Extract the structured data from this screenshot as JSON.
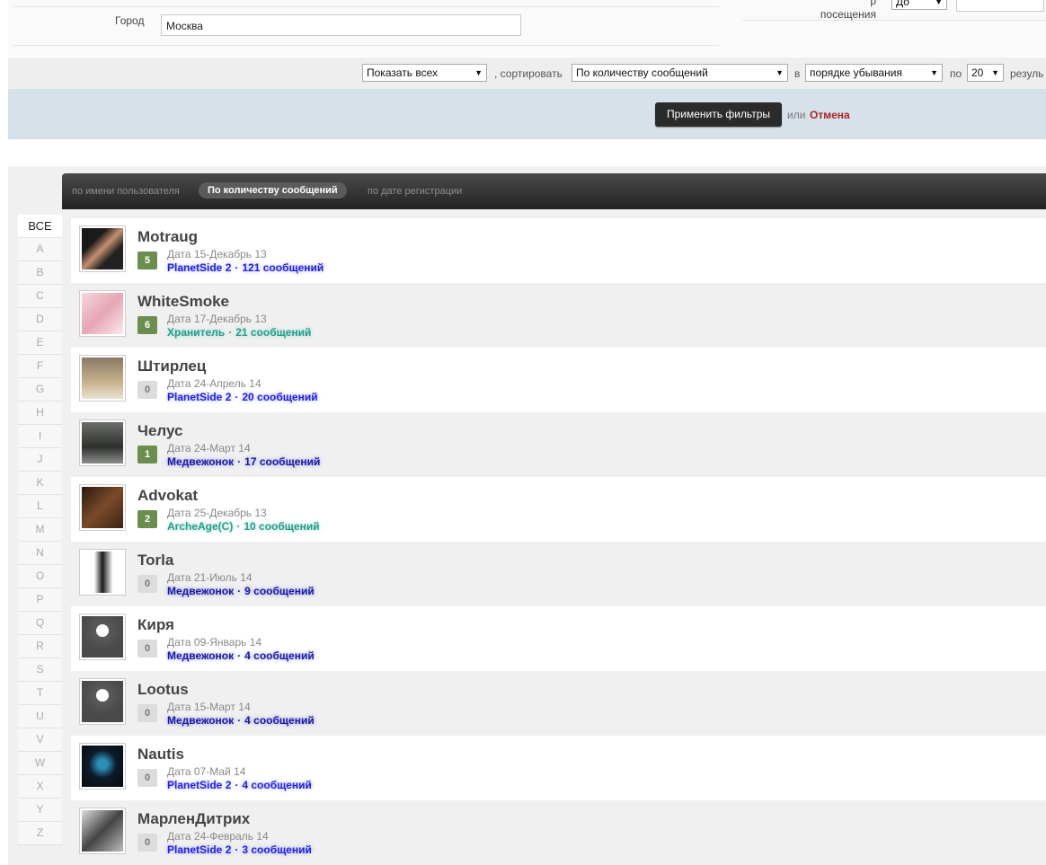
{
  "filters": {
    "city_label": "Город",
    "city_value": "Москва",
    "visit_label": "посещения",
    "visit_select": "До",
    "show_select": "Показать всех",
    "sort_label": ", сортировать",
    "sort_select": "По количеству сообщений",
    "in_label": "в",
    "order_select": "порядке убывания",
    "per_label": "по",
    "per_select": "20",
    "results_label": "резуль",
    "apply_button": "Применить фильтры",
    "or_text": "или",
    "cancel_link": "Отмена"
  },
  "tabs": [
    {
      "label": "по имени пользователя",
      "active": false
    },
    {
      "label": "По количеству сообщений",
      "active": true
    },
    {
      "label": "по дате регистрации",
      "active": false
    }
  ],
  "letters": [
    "ВСЕ",
    "A",
    "B",
    "C",
    "D",
    "E",
    "F",
    "G",
    "H",
    "I",
    "J",
    "K",
    "L",
    "M",
    "N",
    "O",
    "P",
    "Q",
    "R",
    "S",
    "T",
    "U",
    "V",
    "W",
    "X",
    "Y",
    "Z"
  ],
  "members": [
    {
      "name": "Motraug",
      "reputation": "5",
      "date": "Дата 15-Декабрь 13",
      "group": "PlanetSide 2",
      "posts": "121 сообщений"
    },
    {
      "name": "WhiteSmoke",
      "reputation": "6",
      "date": "Дата 17-Декабрь 13",
      "group": "Хранитель",
      "posts": "21 сообщений"
    },
    {
      "name": "Штирлец",
      "reputation": "0",
      "date": "Дата 24-Апрель 14",
      "group": "PlanetSide 2",
      "posts": "20 сообщений"
    },
    {
      "name": "Челус",
      "reputation": "1",
      "date": "Дата 24-Март 14",
      "group": "Медвежонок",
      "posts": "17 сообщений"
    },
    {
      "name": "Advokat",
      "reputation": "2",
      "date": "Дата 25-Декабрь 13",
      "group": "ArcheAge(C)",
      "posts": "10 сообщений"
    },
    {
      "name": "Torla",
      "reputation": "0",
      "date": "Дата 21-Июль 14",
      "group": "Медвежонок",
      "posts": "9 сообщений"
    },
    {
      "name": "Киря",
      "reputation": "0",
      "date": "Дата 09-Январь 14",
      "group": "Медвежонок",
      "posts": "4 сообщений"
    },
    {
      "name": "Lootus",
      "reputation": "0",
      "date": "Дата 15-Март 14",
      "group": "Медвежонок",
      "posts": "4 сообщений"
    },
    {
      "name": "Nautis",
      "reputation": "0",
      "date": "Дата 07-Май 14",
      "group": "PlanetSide 2",
      "posts": "4 сообщений"
    },
    {
      "name": "МарленДитрих",
      "reputation": "0",
      "date": "Дата 24-Февраль 14",
      "group": "PlanetSide 2",
      "posts": "3 сообщений"
    }
  ],
  "separator": "·"
}
